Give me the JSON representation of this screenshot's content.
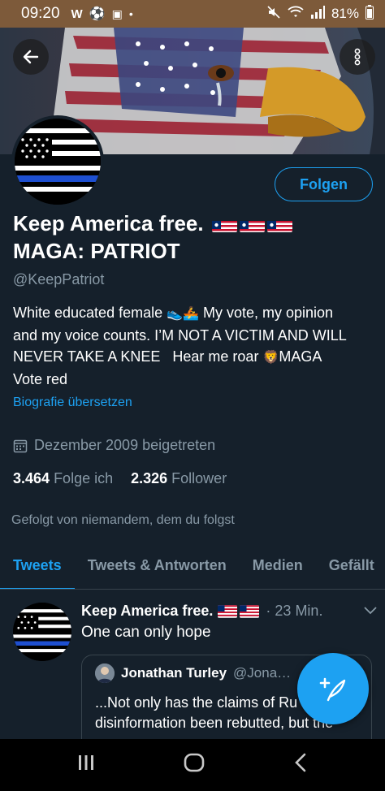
{
  "status_bar": {
    "time": "09:20",
    "left_icons": [
      "w-app-icon",
      "soccer-icon",
      "game-icon",
      "dot-icon"
    ],
    "battery": "81%",
    "right_icons": [
      "mute-icon",
      "wifi-icon",
      "signal-icon",
      "battery-icon"
    ]
  },
  "profile": {
    "follow_label": "Folgen",
    "name_line1": "Keep America free.",
    "name_line2": "MAGA: PATRIOT",
    "handle": "@KeepPatriot",
    "bio_line1a": "White educated female",
    "bio_line1b": "My vote, my opinion",
    "bio_line2": "and my voice counts. I’M NOT A VICTIM AND WILL",
    "bio_line3a": "NEVER TAKE A KNEE   Hear me roar",
    "bio_line3b": "MAGA",
    "bio_line4": "Vote red",
    "translate_label": "Biografie übersetzen",
    "joined": "Dezember 2009 beigetreten",
    "following_count": "3.464",
    "following_label": "Folge ich",
    "followers_count": "2.326",
    "followers_label": "Follower",
    "followed_by": "Gefolgt von niemandem, dem du folgst"
  },
  "tabs": [
    {
      "label": "Tweets",
      "active": true
    },
    {
      "label": "Tweets & Antworten",
      "active": false
    },
    {
      "label": "Medien",
      "active": false
    },
    {
      "label": "Gefällt",
      "active": false
    }
  ],
  "tweet": {
    "name": "Keep America free.",
    "ellipsis": "·",
    "time": "· 23 Min.",
    "text": "One can only hope",
    "quote": {
      "name": "Jonathan Turley",
      "handle": "@Jona…",
      "line1": "...Not only has the claims of Ru",
      "line2": "disinformation been rebutted, but the"
    }
  },
  "colors": {
    "background": "#15202b",
    "accent": "#1da1f2",
    "muted": "#8899a6",
    "status_bar": "#7d5a3a"
  }
}
